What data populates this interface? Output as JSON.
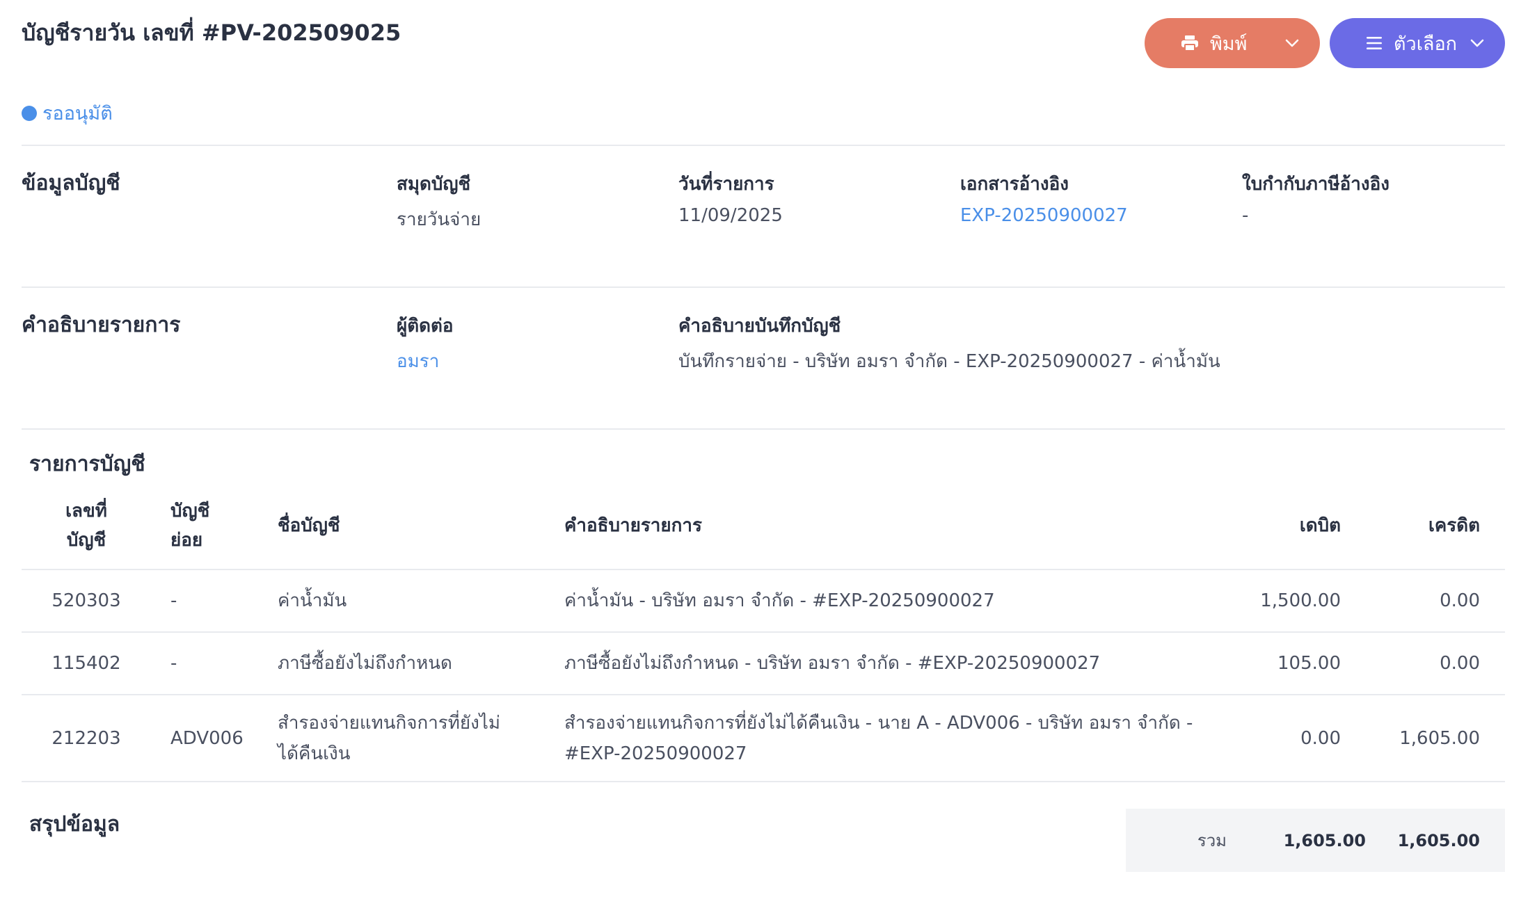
{
  "header": {
    "title": "บัญชีรายวัน เลขที่ #PV-202509025",
    "status": "รออนุมัติ",
    "print_button": "พิมพ์",
    "options_button": "ตัวเลือก"
  },
  "account_info": {
    "section_label": "ข้อมูลบัญชี",
    "book_label": "สมุดบัญชี",
    "book_value": "รายวันจ่าย",
    "date_label": "วันที่รายการ",
    "date_value": "11/09/2025",
    "ref_doc_label": "เอกสารอ้างอิง",
    "ref_doc_value": "EXP-20250900027",
    "tax_invoice_label": "ใบกำกับภาษีอ้างอิง",
    "tax_invoice_value": "-"
  },
  "description": {
    "section_label": "คำอธิบายรายการ",
    "contact_label": "ผู้ติดต่อ",
    "contact_value": "อมรา",
    "memo_label": "คำอธิบายบันทึกบัญชี",
    "memo_value": "บันทึกรายจ่าย - บริษัท อมรา จำกัด - EXP-20250900027 - ค่าน้ำมัน"
  },
  "ledger": {
    "section_label": "รายการบัญชี",
    "columns": {
      "account_no_1": "เลขที่",
      "account_no_2": "บัญชี",
      "sub_account_1": "บัญชี",
      "sub_account_2": "ย่อย",
      "account_name": "ชื่อบัญชี",
      "description": "คำอธิบายรายการ",
      "debit": "เดบิต",
      "credit": "เครดิต"
    },
    "rows": [
      {
        "account_no": "520303",
        "sub_account": "-",
        "account_name": "ค่าน้ำมัน",
        "description": "ค่าน้ำมัน - บริษัท อมรา จำกัด - #EXP-20250900027",
        "debit": "1,500.00",
        "credit": "0.00"
      },
      {
        "account_no": "115402",
        "sub_account": "-",
        "account_name": "ภาษีซื้อยังไม่ถึงกำหนด",
        "description": "ภาษีซื้อยังไม่ถึงกำหนด - บริษัท อมรา จำกัด - #EXP-20250900027",
        "debit": "105.00",
        "credit": "0.00"
      },
      {
        "account_no": "212203",
        "sub_account": "ADV006",
        "account_name_1": "สำรองจ่ายแทนกิจการที่ยังไม่",
        "account_name_2": "ได้คืนเงิน",
        "description_1": "สำรองจ่ายแทนกิจการที่ยังไม่ได้คืนเงิน - นาย A - ADV006 - บริษัท อมรา จำกัด -",
        "description_2": "#EXP-20250900027",
        "debit": "0.00",
        "credit": "1,605.00"
      }
    ]
  },
  "summary": {
    "section_label": "สรุปข้อมูล",
    "total_label": "รวม",
    "total_debit": "1,605.00",
    "total_credit": "1,605.00"
  },
  "colors": {
    "print_button": "#e57c65",
    "options_button": "#6b6be6",
    "link": "#4a8fe8",
    "status": "#4a8fe8"
  }
}
